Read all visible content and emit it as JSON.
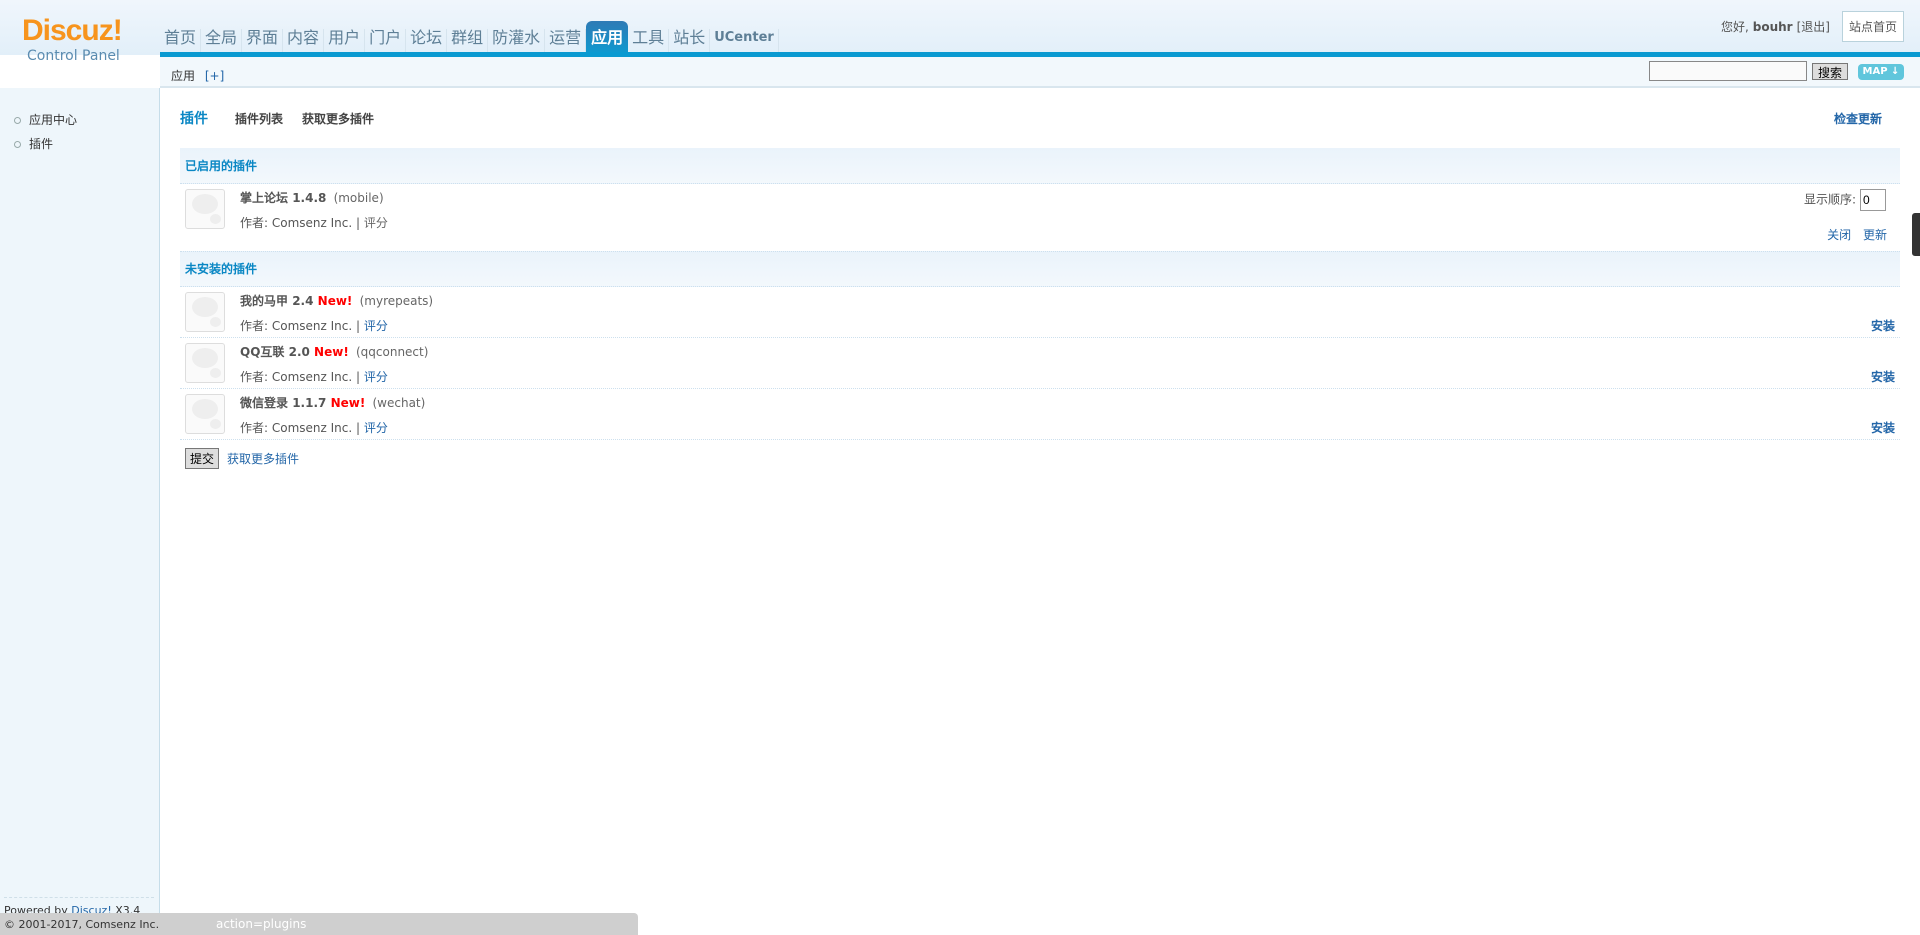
{
  "logo": {
    "brand": "Discuz!",
    "sub": "Control Panel"
  },
  "nav": [
    "首页",
    "全局",
    "界面",
    "内容",
    "用户",
    "门户",
    "论坛",
    "群组",
    "防灌水",
    "运营",
    "应用",
    "工具",
    "站长",
    "UCenter"
  ],
  "nav_active": "应用",
  "user": {
    "greeting": "您好,",
    "name": "bouhr",
    "logout": "[退出]",
    "site_home": "站点首页"
  },
  "subbar": {
    "crumb": "应用",
    "add": "[+]",
    "search_value": "",
    "search_button": "搜索",
    "map_button": "MAP ↓"
  },
  "sidebar": {
    "items": [
      "应用中心",
      "插件"
    ]
  },
  "footer": {
    "powered": "Powered by ",
    "link": "Discuz!",
    "version": " X3.4",
    "copyright": "© 2001-2017, Comsenz Inc.",
    "status_url": "action=plugins"
  },
  "tabs": {
    "current": "插件",
    "list": "插件列表",
    "more": "获取更多插件",
    "check_update": "检查更新"
  },
  "enabled": {
    "heading": "已启用的插件",
    "plugins": [
      {
        "name": "掌上论坛",
        "version": "1.4.8",
        "id": "(mobile)",
        "author": "作者: Comsenz Inc.",
        "sep": "|",
        "rate": "评分",
        "order_label": "显示顺序:",
        "order": "0",
        "close": "关闭",
        "update": "更新"
      }
    ]
  },
  "uninstalled": {
    "heading": "未安装的插件",
    "plugins": [
      {
        "name": "我的马甲",
        "version": "2.4",
        "new": "New!",
        "id": "(myrepeats)",
        "author": "作者: Comsenz Inc.",
        "sep": "|",
        "rate": "评分",
        "install": "安装"
      },
      {
        "name": "QQ互联",
        "version": "2.0",
        "new": "New!",
        "id": "(qqconnect)",
        "author": "作者: Comsenz Inc.",
        "sep": "|",
        "rate": "评分",
        "install": "安装"
      },
      {
        "name": "微信登录",
        "version": "1.1.7",
        "new": "New!",
        "id": "(wechat)",
        "author": "作者: Comsenz Inc.",
        "sep": "|",
        "rate": "评分",
        "install": "安装"
      }
    ]
  },
  "submit": {
    "button": "提交",
    "more": "获取更多插件"
  }
}
